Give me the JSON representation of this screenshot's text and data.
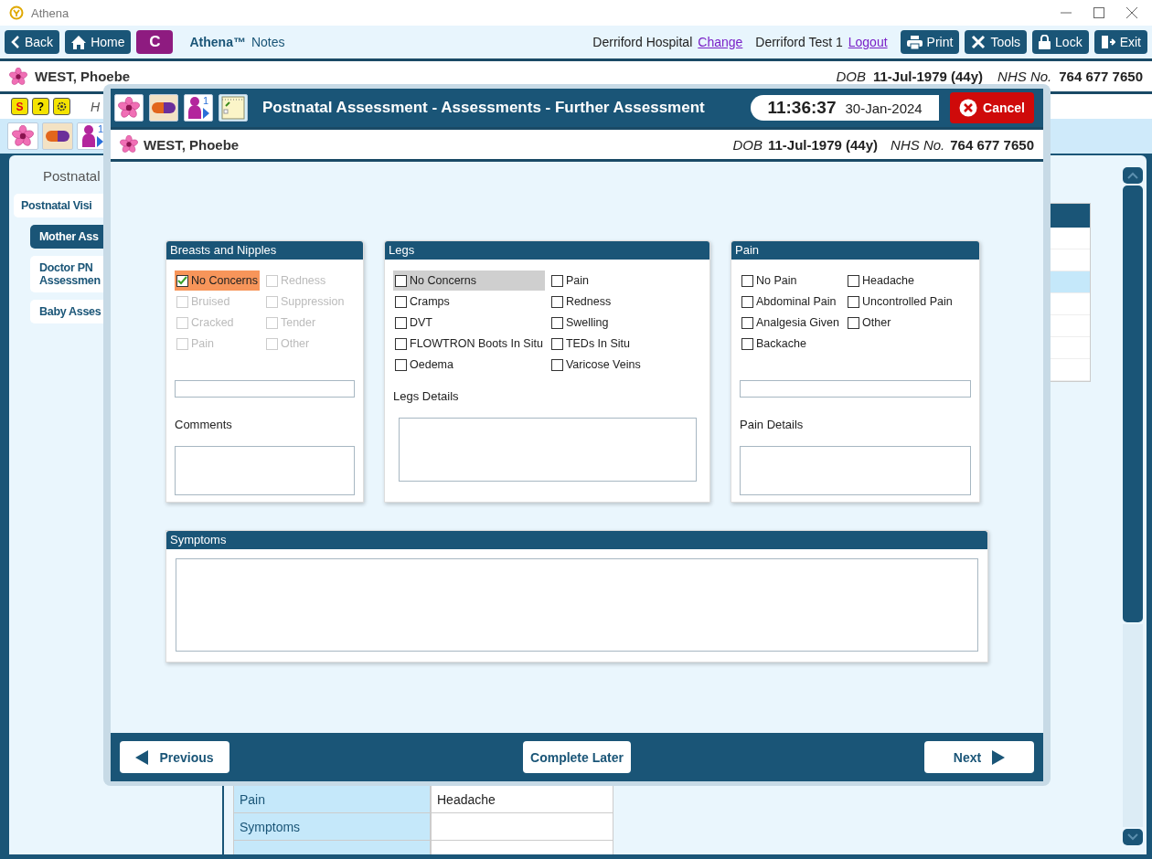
{
  "window": {
    "title": "Athena"
  },
  "toolbar": {
    "nav_buttons": [
      {
        "label": "Back"
      },
      {
        "label": "Home"
      }
    ],
    "app_badge": "C",
    "app_name": "Athena™",
    "app_section": "Notes",
    "hospital": "Derriford Hospital",
    "change_link": "Change",
    "user": "Derriford Test 1",
    "logout_link": "Logout",
    "actions": [
      {
        "label": "Print"
      },
      {
        "label": "Tools"
      },
      {
        "label": "Lock"
      },
      {
        "label": "Exit"
      }
    ]
  },
  "patient": {
    "name": "WEST, Phoebe",
    "dob_label": "DOB",
    "dob": "11-Jul-1979 (44y)",
    "nhs_label": "NHS No.",
    "nhs": "764 677 7650"
  },
  "alert_icons": {
    "alert_letter": "S",
    "help_mark": "?"
  },
  "hint_text": "H",
  "episode_count": "1",
  "breadcrumb": "Postnatal",
  "nav": [
    {
      "label": "Postnatal Visi",
      "selected": false,
      "children": [
        {
          "label": "Mother Ass",
          "selected": true
        },
        {
          "label": "Doctor PN Assessmen",
          "selected": false
        },
        {
          "label": "Baby Asses",
          "selected": false
        }
      ]
    }
  ],
  "summary_table": {
    "rows": [
      {
        "label": "Pain",
        "value": "Headache"
      },
      {
        "label": "Symptoms"
      }
    ]
  },
  "side_table": {
    "rows": [
      {
        "selected": false
      },
      {
        "selected": false
      },
      {
        "selected": true
      },
      {
        "selected": false
      },
      {
        "selected": false
      },
      {
        "selected": false
      },
      {
        "selected": false
      }
    ]
  },
  "modal": {
    "title": "Postnatal Assessment - Assessments - Further Assessment",
    "time": "11:36:37",
    "date": "30-Jan-2024",
    "cancel": "Cancel",
    "episode_count": "1",
    "patient": {
      "name": "WEST, Phoebe",
      "dob_label": "DOB",
      "dob": "11-Jul-1979 (44y)",
      "nhs_label": "NHS No.",
      "nhs": "764 677 7650"
    },
    "panels": [
      {
        "title": "Breasts and Nipples",
        "has_field": true,
        "details_label": "Comments",
        "options": [
          {
            "label": "No Concerns",
            "checked": true,
            "disabled": false,
            "focused": false
          },
          {
            "label": "Redness",
            "checked": false,
            "disabled": true,
            "focused": false
          },
          {
            "label": "Bruised",
            "checked": false,
            "disabled": true,
            "focused": false
          },
          {
            "label": "Suppression",
            "checked": false,
            "disabled": true,
            "focused": false
          },
          {
            "label": "Cracked",
            "checked": false,
            "disabled": true,
            "focused": false
          },
          {
            "label": "Tender",
            "checked": false,
            "disabled": true,
            "focused": false
          },
          {
            "label": "Pain",
            "checked": false,
            "disabled": true,
            "focused": false
          },
          {
            "label": "Other",
            "checked": false,
            "disabled": true,
            "focused": false
          }
        ]
      },
      {
        "title": "Legs",
        "details_label": "Legs Details",
        "options": [
          {
            "label": "No Concerns",
            "checked": false,
            "disabled": false,
            "focused": true
          },
          {
            "label": "Pain",
            "checked": false,
            "disabled": false,
            "focused": false
          },
          {
            "label": "Cramps",
            "checked": false,
            "disabled": false,
            "focused": false
          },
          {
            "label": "Redness",
            "checked": false,
            "disabled": false,
            "focused": false
          },
          {
            "label": "DVT",
            "checked": false,
            "disabled": false,
            "focused": false
          },
          {
            "label": "Swelling",
            "checked": false,
            "disabled": false,
            "focused": false
          },
          {
            "label": "FLOWTRON Boots In Situ",
            "checked": false,
            "disabled": false,
            "focused": false
          },
          {
            "label": "TEDs In Situ",
            "checked": false,
            "disabled": false,
            "focused": false
          },
          {
            "label": "Oedema",
            "checked": false,
            "disabled": false,
            "focused": false
          },
          {
            "label": "Varicose Veins",
            "checked": false,
            "disabled": false,
            "focused": false
          }
        ]
      },
      {
        "title": "Pain",
        "has_field": true,
        "details_label": "Pain Details",
        "options": [
          {
            "label": "No Pain",
            "checked": false,
            "disabled": false,
            "focused": false
          },
          {
            "label": "Headache",
            "checked": false,
            "disabled": false,
            "focused": false
          },
          {
            "label": "Abdominal Pain",
            "checked": false,
            "disabled": false,
            "focused": false
          },
          {
            "label": "Uncontrolled Pain",
            "checked": false,
            "disabled": false,
            "focused": false
          },
          {
            "label": "Analgesia Given",
            "checked": false,
            "disabled": false,
            "focused": false
          },
          {
            "label": "Other",
            "checked": false,
            "disabled": false,
            "focused": false
          },
          {
            "label": "Backache",
            "checked": false,
            "disabled": false,
            "focused": false
          }
        ]
      }
    ],
    "symptoms": {
      "title": "Symptoms"
    },
    "footer": {
      "previous": "Previous",
      "complete_later": "Complete Later",
      "next": "Next"
    }
  }
}
